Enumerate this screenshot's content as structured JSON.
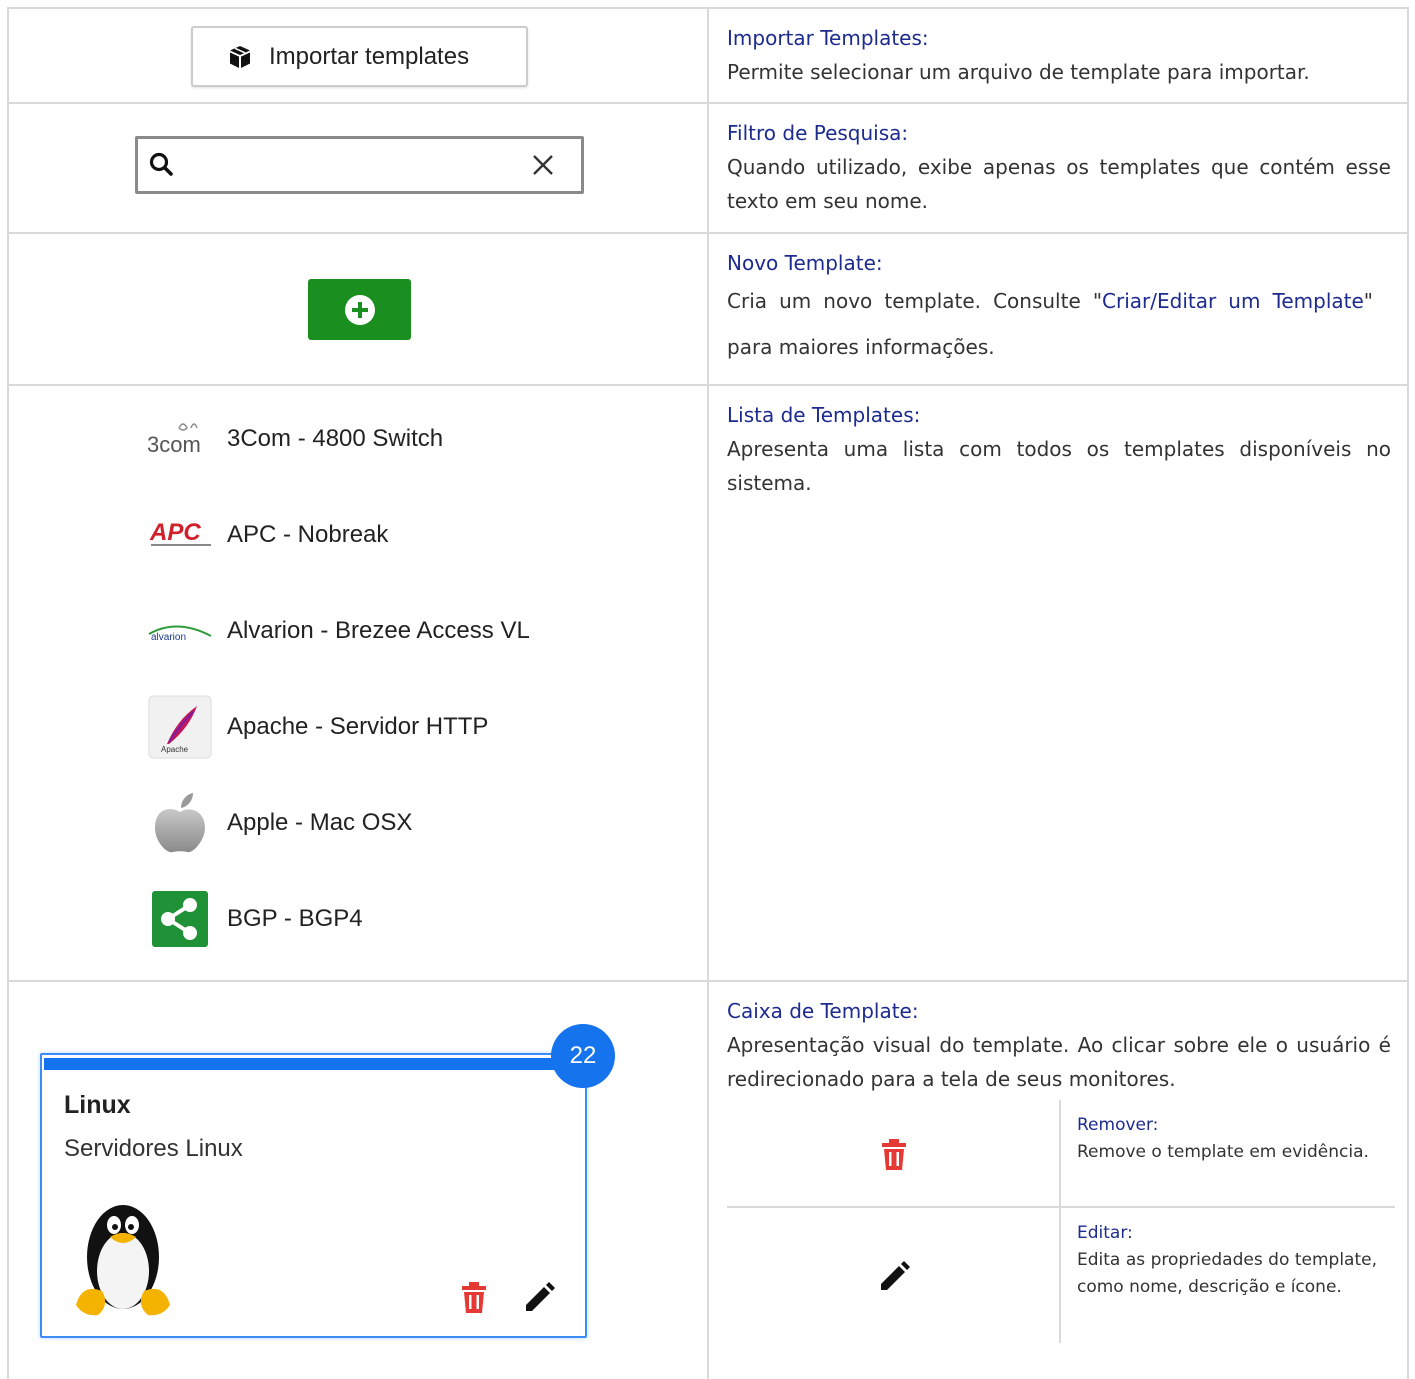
{
  "rows": {
    "import": {
      "button_label": "Importar templates",
      "title": "Importar Templates:",
      "text": "Permite selecionar um arquivo de template para importar."
    },
    "filter": {
      "placeholder": "",
      "title": "Filtro de Pesquisa:",
      "text": "Quando utilizado, exibe apenas os templates que contém esse texto em seu nome."
    },
    "new": {
      "title": "Novo Template:",
      "text_before": "Cria um novo template. Consulte \"",
      "link": "Criar/Editar um Template",
      "text_after": "\" para maiores informações."
    },
    "list": {
      "items": [
        {
          "name": "3Com - 4800 Switch",
          "icon": "3com-logo-icon"
        },
        {
          "name": "APC - Nobreak",
          "icon": "apc-logo-icon"
        },
        {
          "name": "Alvarion - Brezee Access VL",
          "icon": "alvarion-logo-icon"
        },
        {
          "name": "Apache - Servidor HTTP",
          "icon": "apache-feather-icon"
        },
        {
          "name": "Apple - Mac OSX",
          "icon": "apple-logo-icon"
        },
        {
          "name": "BGP - BGP4",
          "icon": "share-icon"
        }
      ],
      "title": "Lista de Templates:",
      "text": "Apresenta uma lista com todos os templates disponíveis no sistema."
    },
    "box": {
      "card": {
        "count": "22",
        "title": "Linux",
        "description": "Servidores Linux",
        "icon": "tux-penguin-icon"
      },
      "title": "Caixa de Template:",
      "text": "Apresentação visual do template. Ao clicar sobre ele o usuário é redirecionado para a tela de seus monitores.",
      "actions": [
        {
          "icon": "trash-icon",
          "title": "Remover:",
          "text": "Remove o template em evidência."
        },
        {
          "icon": "pencil-icon",
          "title": "Editar:",
          "text": "Edita as propriedades do template, como nome, descrição e ícone."
        }
      ]
    }
  },
  "colors": {
    "title_blue": "#1d2b8f",
    "accent_blue": "#1573ee",
    "green": "#1a8f1f",
    "delete_red": "#e53935"
  }
}
